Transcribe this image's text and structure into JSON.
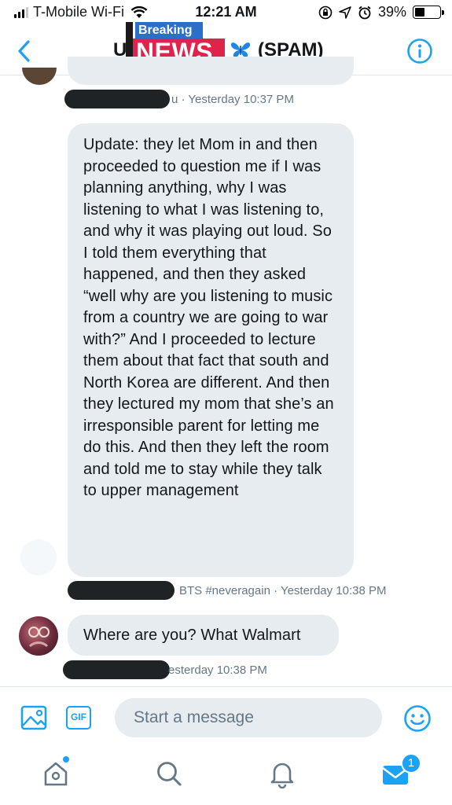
{
  "status_bar": {
    "carrier": "T-Mobile Wi-Fi",
    "time": "12:21 AM",
    "battery": "39%",
    "battery_level": 0.39,
    "icons": [
      "signal-icon",
      "wifi-icon",
      "screen-rotation-lock-icon",
      "location-arrow-icon",
      "alarm-icon",
      "battery-icon"
    ]
  },
  "header": {
    "title_start": "U",
    "title_end": "(SPAM)",
    "overlay_top": "Breaking",
    "overlay_bottom": "NEWS",
    "back_icon": "chevron-left-icon",
    "info_icon": "info-icon",
    "butterfly_icon": "butterfly-emoji-icon"
  },
  "messages": [
    {
      "meta_text": "u · Yesterday 10:37 PM"
    },
    {
      "text": "Update: they let Mom in and then proceeded to question me if I was planning anything, why I was listening to what I was listening to, and why it was playing out loud. So I told them everything that happened, and then they asked “well why are you listening to music from a country we are going to war with?” And I proceeded to lecture them about that fact that south and North Korea are different. And then they lectured my mom that she’s an irresponsible parent for letting me do this. And then they left the room and told me to stay while they talk to upper management",
      "meta_text": "BTS #neveragain · Yesterday 10:38 PM"
    },
    {
      "text": "Where are you? What Walmart",
      "meta_text": "esterday 10:38 PM"
    }
  ],
  "composer": {
    "placeholder": "Start a message",
    "gif_label": "GIF"
  },
  "bottom_nav": {
    "messages_badge": "1"
  },
  "colors": {
    "accent": "#1da1f2",
    "bubble": "#e6ecf0",
    "breaking_blue": "#2b6fc9",
    "news_red": "#e0234b"
  }
}
